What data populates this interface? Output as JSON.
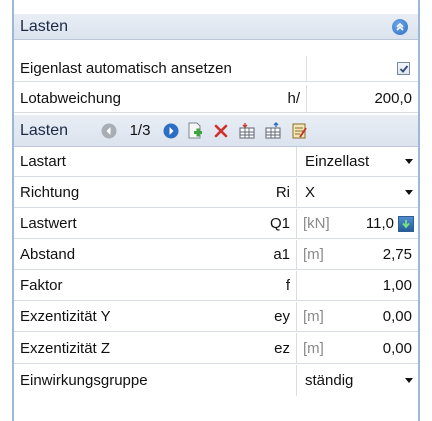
{
  "section": {
    "title": "Lasten"
  },
  "eigenlast": {
    "label": "Eigenlast automatisch ansetzen",
    "checked": true
  },
  "lotabweichung": {
    "label": "Lotabweichung",
    "symbol": "h/",
    "value": "200,0"
  },
  "loads_toolbar": {
    "title": "Lasten",
    "pager": "1/3"
  },
  "rows": [
    {
      "label": "Lastart",
      "symbol": "",
      "unit": "",
      "value": "Einzellast",
      "type": "select"
    },
    {
      "label": "Richtung",
      "symbol": "Ri",
      "unit": "",
      "value": "X",
      "type": "select"
    },
    {
      "label": "Lastwert",
      "symbol": "Q1",
      "unit": "[kN]",
      "value": "11,0",
      "type": "value-button"
    },
    {
      "label": "Abstand",
      "symbol": "a1",
      "unit": "[m]",
      "value": "2,75",
      "type": "value"
    },
    {
      "label": "Faktor",
      "symbol": "f",
      "unit": "",
      "value": "1,00",
      "type": "value"
    },
    {
      "label": "Exzentizität Y",
      "symbol": "ey",
      "unit": "[m]",
      "value": "0,00",
      "type": "value"
    },
    {
      "label": "Exzentizität Z",
      "symbol": "ez",
      "unit": "[m]",
      "value": "0,00",
      "type": "value"
    },
    {
      "label": "Einwirkungsgruppe",
      "symbol": "",
      "unit": "",
      "value": "ständig",
      "type": "select"
    }
  ],
  "colors": {
    "header_bg": "#dbe3ee",
    "accent_blue": "#2d6fc4",
    "grid_line": "#d9dee5",
    "delete_red": "#d0312d",
    "add_green": "#3aa53a"
  },
  "icons": [
    "collapse-up-icon",
    "checkbox-checked-icon",
    "previous-icon",
    "next-icon",
    "add-load-icon",
    "delete-load-icon",
    "import-table-icon",
    "export-table-icon",
    "edit-list-icon",
    "dropdown-arrow-icon",
    "download-arrow-icon"
  ]
}
